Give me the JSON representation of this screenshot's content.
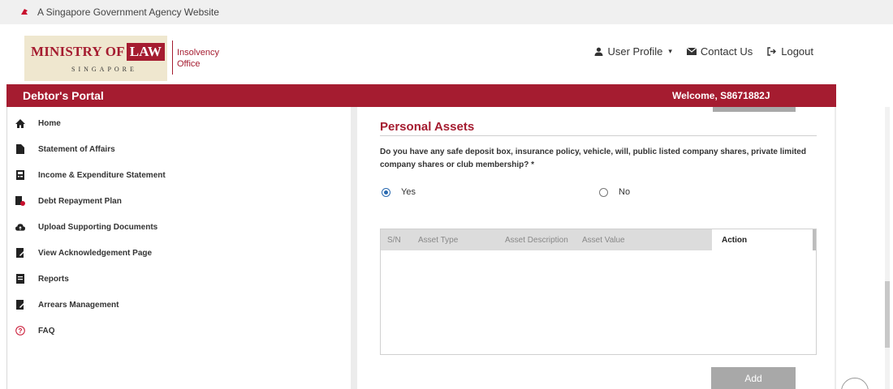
{
  "gov_strip": {
    "text": "A Singapore Government Agency Website",
    "icon": "lion-head-icon"
  },
  "logo": {
    "ministry": "MINISTRY OF",
    "law": "LAW",
    "country": "SINGAPORE",
    "office_line1": "Insolvency",
    "office_line2": "Office"
  },
  "top_nav": {
    "user_profile": "User Profile",
    "contact_us": "Contact Us",
    "logout": "Logout"
  },
  "portal_bar": {
    "title": "Debtor's Portal",
    "welcome": "Welcome, S8671882J"
  },
  "sidebar": {
    "items": [
      {
        "label": "Home",
        "icon": "home-icon"
      },
      {
        "label": "Statement of Affairs",
        "icon": "document-icon"
      },
      {
        "label": "Income & Expenditure Statement",
        "icon": "ledger-icon"
      },
      {
        "label": "Debt Repayment Plan",
        "icon": "plan-icon"
      },
      {
        "label": "Upload Supporting Documents",
        "icon": "cloud-upload-icon"
      },
      {
        "label": "View Acknowledgement Page",
        "icon": "edit-document-icon"
      },
      {
        "label": "Reports",
        "icon": "report-icon"
      },
      {
        "label": "Arrears Management",
        "icon": "edit-document-icon"
      },
      {
        "label": "FAQ",
        "icon": "question-circle-icon"
      }
    ]
  },
  "main": {
    "section_title": "Personal Assets",
    "question": "Do you have any safe deposit box, insurance policy, vehicle, will, public listed company shares, private limited company shares or club membership? *",
    "radio_yes": "Yes",
    "radio_no": "No",
    "selected": "Yes",
    "table_headers": [
      "S/N",
      "Asset Type",
      "Asset Description",
      "Asset Value",
      "Action"
    ],
    "add_button": "Add"
  },
  "colors": {
    "brand_red": "#a51c30",
    "radio_blue": "#2a6ab0",
    "button_gray": "#a8a8a8"
  }
}
